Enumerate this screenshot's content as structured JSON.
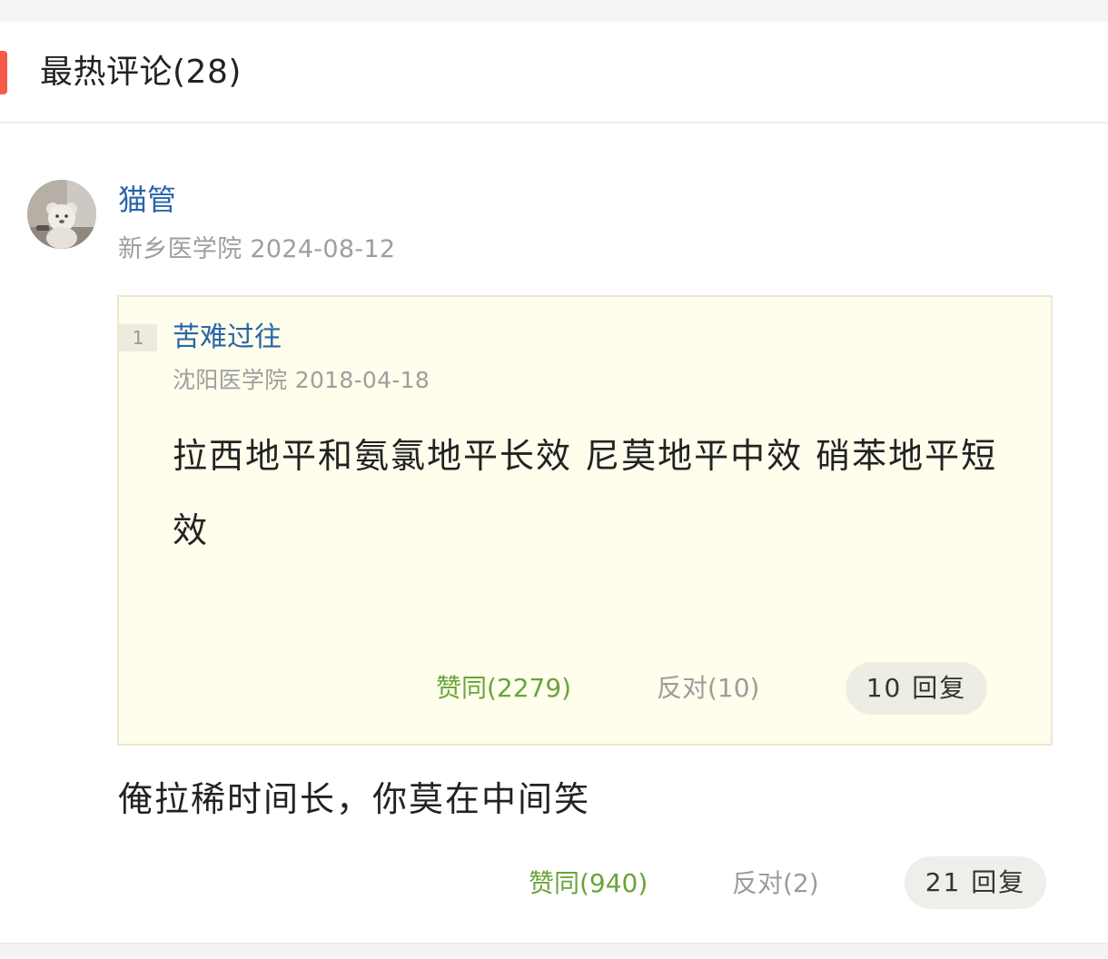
{
  "section": {
    "title": "最热评论(28)",
    "accent_color": "#f45b4b"
  },
  "comment": {
    "username": "猫管",
    "school": "新乡医学院",
    "date": "2024-08-12",
    "avatar_icon": "teddy-bear-avatar",
    "content": "俺拉稀时间长，你莫在中间笑",
    "agree_label": "赞同(940)",
    "disagree_label": "反对(2)",
    "reply_label": "21 回复"
  },
  "quote": {
    "floor": "1",
    "username": "苦难过往",
    "school": "沈阳医学院",
    "date": "2018-04-18",
    "content": "拉西地平和氨氯地平长效 尼莫地平中效 硝苯地平短效",
    "agree_label": "赞同(2279)",
    "disagree_label": "反对(10)",
    "reply_label": "10 回复"
  },
  "colors": {
    "link_blue": "#2a65a8",
    "agree_green": "#6aa43a",
    "muted_gray": "#9e9e9e",
    "quote_bg": "#fffdec"
  }
}
